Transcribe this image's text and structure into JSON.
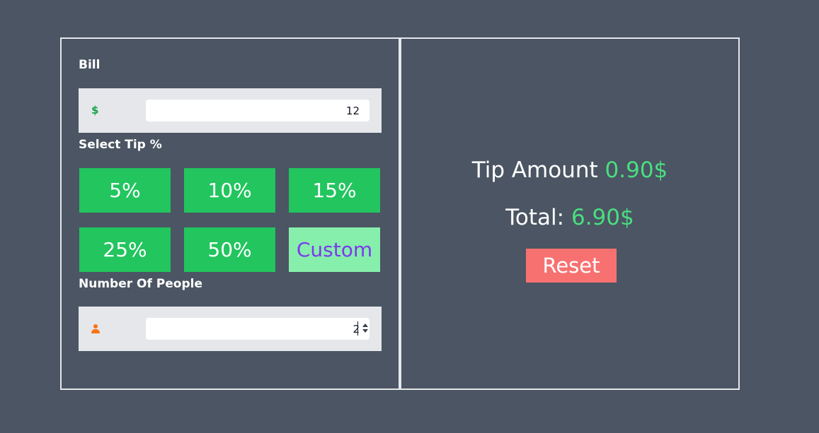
{
  "bill": {
    "label": "Bill",
    "currency_symbol": "$",
    "value": "12"
  },
  "tip": {
    "label": "Select Tip %",
    "options": [
      "5%",
      "10%",
      "15%",
      "25%",
      "50%"
    ],
    "custom_label": "Custom"
  },
  "people": {
    "label": "Number Of People",
    "icon": "person-icon",
    "value": "2"
  },
  "results": {
    "tip_label": "Tip Amount",
    "tip_value": "0.90$",
    "total_label": "Total:",
    "total_value": "6.90$",
    "reset_label": "Reset"
  },
  "colors": {
    "background": "#4b5563",
    "tip_button": "#22c55e",
    "custom_button": "#86efac",
    "custom_text": "#7c3aed",
    "result_value": "#4ade80",
    "reset_button": "#f87171",
    "person_icon": "#f97316"
  }
}
